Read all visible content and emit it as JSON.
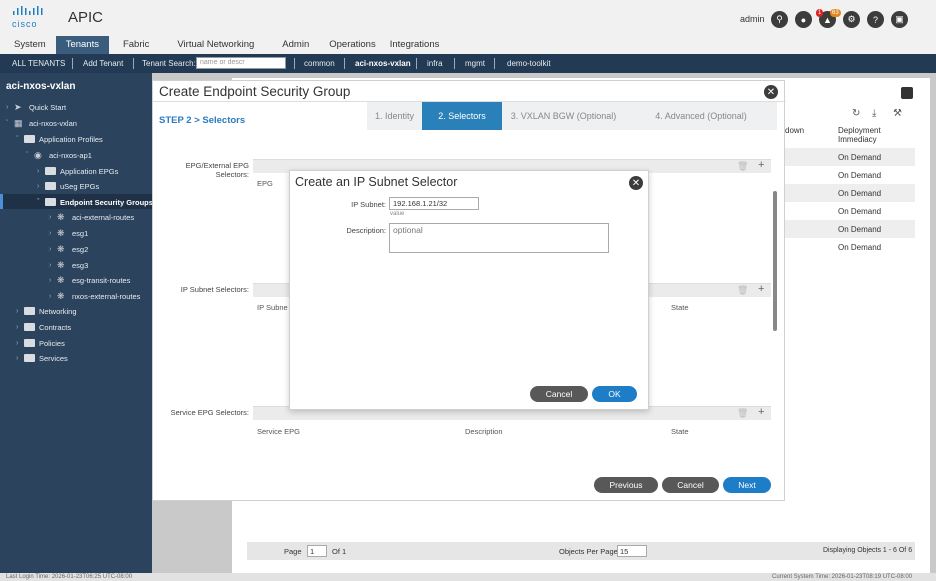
{
  "header": {
    "logo_text": "cisco",
    "app_title": "APIC",
    "user": "admin",
    "badge_count": "1",
    "badge_alerts": "63"
  },
  "tabs": [
    "System",
    "Tenants",
    "Fabric",
    "Virtual Networking",
    "Admin",
    "Operations",
    "Integrations"
  ],
  "subnav": {
    "all_tenants": "ALL TENANTS",
    "add_tenant": "Add Tenant",
    "search_label": "Tenant Search:",
    "search_placeholder": "name or descr",
    "tenants": [
      "common",
      "aci-nxos-vxlan",
      "infra",
      "mgmt",
      "demo-toolkit"
    ]
  },
  "sidebar": {
    "title": "aci-nxos-vxlan",
    "items": [
      "Quick Start",
      "aci-nxos-vxlan",
      "Application Profiles",
      "aci-nxos-ap1",
      "Application EPGs",
      "uSeg EPGs",
      "Endpoint Security Groups",
      "aci-external-routes",
      "esg1",
      "esg2",
      "esg3",
      "esg-transit-routes",
      "nxos-external-routes",
      "Networking",
      "Contracts",
      "Policies",
      "Services"
    ]
  },
  "background": {
    "col_down": "down",
    "col_deploy": "Deployment Immediacy",
    "rows": [
      "On Demand",
      "On Demand",
      "On Demand",
      "On Demand",
      "On Demand",
      "On Demand"
    ],
    "page_label": "Page",
    "page_value": "1",
    "of": "Of 1",
    "per_page_label": "Objects Per Page:",
    "per_page_value": "15",
    "displaying": "Displaying Objects 1 - 6 Of 6"
  },
  "statusbar": {
    "last_login": "Last Login Time: 2026-01-23T06:25 UTC-08:00",
    "system_time": "Current System Time: 2026-01-23T08:19 UTC-08:00"
  },
  "esg_modal": {
    "title": "Create Endpoint Security Group",
    "step_label": "STEP 2 > Selectors",
    "steps": [
      "1. Identity",
      "2. Selectors",
      "3. VXLAN BGW (Optional)",
      "4. Advanced (Optional)"
    ],
    "epg_label": "EPG/External EPG Selectors:",
    "epg_col": "EPG",
    "ip_label": "IP Subnet Selectors:",
    "ip_col": "IP Subne",
    "ip_state": "State",
    "svc_label": "Service EPG Selectors:",
    "svc_col": "Service EPG",
    "svc_desc": "Description",
    "svc_state": "State",
    "previous": "Previous",
    "cancel": "Cancel",
    "next": "Next"
  },
  "ip_modal": {
    "title": "Create an IP Subnet Selector",
    "ip_label": "IP Subnet:",
    "ip_value": "192.168.1.21/32",
    "ip_hint": "value",
    "desc_label": "Description:",
    "desc_placeholder": "optional",
    "cancel": "Cancel",
    "ok": "OK"
  }
}
